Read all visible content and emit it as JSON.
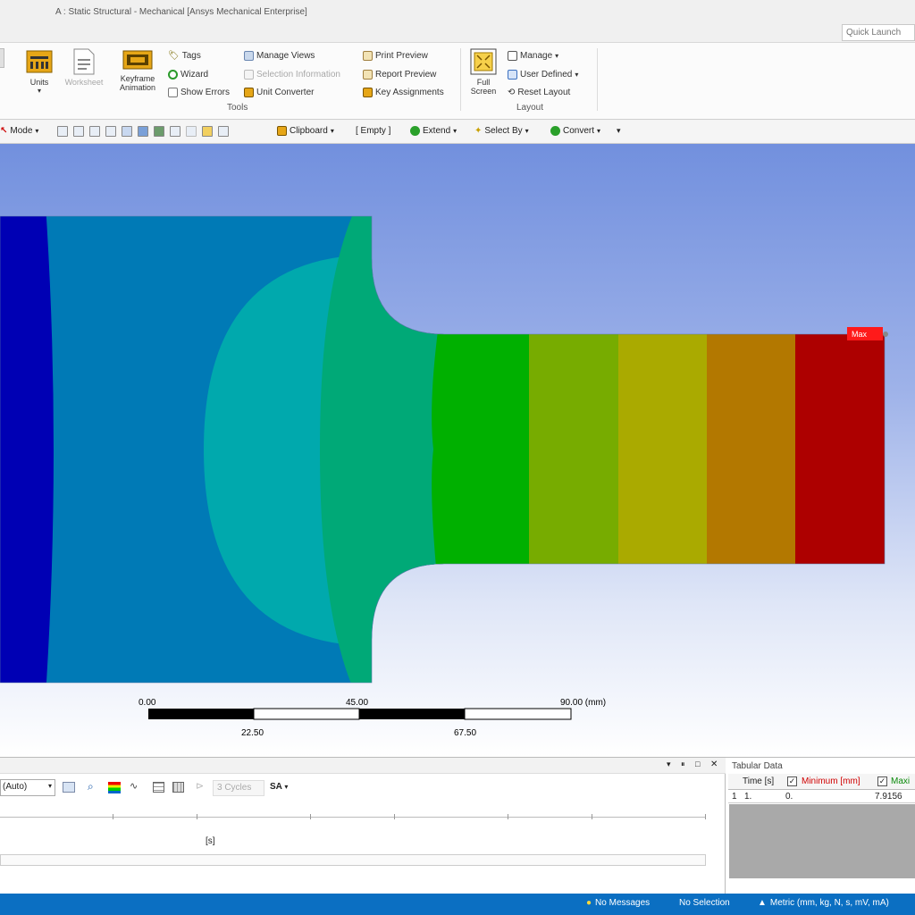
{
  "window": {
    "title": "A : Static Structural - Mechanical [Ansys Mechanical Enterprise]",
    "quick_launch_placeholder": "Quick Launch"
  },
  "ribbon": {
    "units_label": "Units",
    "worksheet_label": "Worksheet",
    "keyframe_label_1": "Keyframe",
    "keyframe_label_2": "Animation",
    "tags_label": "Tags",
    "wizard_label": "Wizard",
    "show_errors_label": "Show Errors",
    "manage_views_label": "Manage Views",
    "selection_information_label": "Selection Information",
    "unit_converter_label": "Unit Converter",
    "print_preview_label": "Print Preview",
    "report_preview_label": "Report Preview",
    "key_assignments_label": "Key Assignments",
    "tools_group": "Tools",
    "full_screen_label_1": "Full",
    "full_screen_label_2": "Screen",
    "manage_label": "Manage",
    "user_defined_label": "User Defined",
    "reset_layout_label": "Reset Layout",
    "layout_group": "Layout"
  },
  "toolbar": {
    "mode_label": "Mode",
    "clipboard_label": "Clipboard",
    "empty_label": "[ Empty ]",
    "extend_label": "Extend",
    "select_by_label": "Select By",
    "convert_label": "Convert"
  },
  "viewport": {
    "max_label": "Max",
    "scale_top_labels": [
      "0.00",
      "45.00",
      "90.00 (mm)"
    ],
    "scale_bottom_labels": [
      "22.50",
      "67.50"
    ],
    "contour_colors": [
      "#0000b4",
      "#007ab6",
      "#00a9ad",
      "#00a977",
      "#00b000",
      "#77ac00",
      "#aaaa00",
      "#b37800",
      "#ad0000"
    ]
  },
  "graph": {
    "auto_label": "(Auto)",
    "cycles_label": "3 Cycles",
    "sa_label": "SA",
    "axis_label": "[s]"
  },
  "tabular": {
    "title": "Tabular Data",
    "col_time": "Time [s]",
    "col_min": "Minimum [mm]",
    "col_max": "Maxi",
    "row_index": "1",
    "row_time": "1.",
    "row_min": "0.",
    "row_max": "7.9156"
  },
  "status": {
    "messages": "No Messages",
    "selection": "No Selection",
    "units": "Metric (mm, kg, N, s, mV, mA)"
  }
}
